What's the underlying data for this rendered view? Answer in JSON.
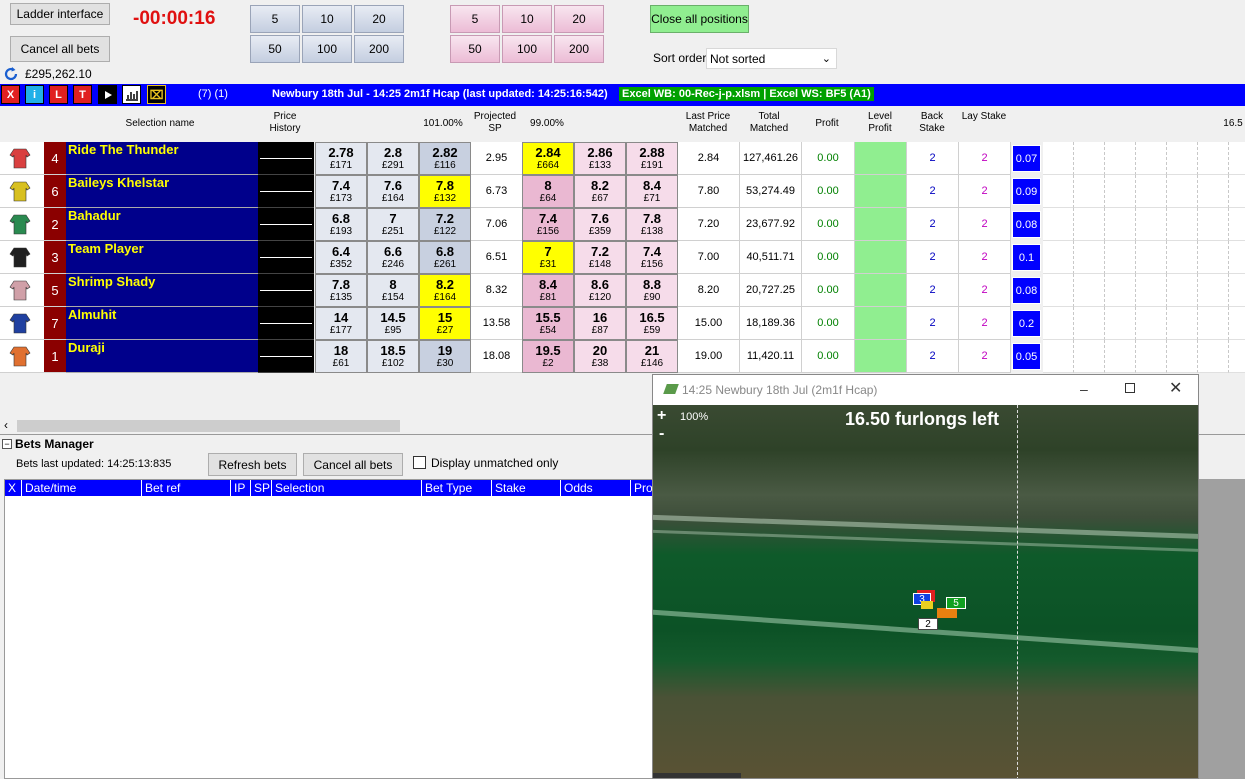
{
  "controls": {
    "ladder_btn": "Ladder interface",
    "cancel_all_btn": "Cancel all bets",
    "timer": "-00:00:16",
    "balance": "£295,262.10",
    "back_stakes": [
      "5",
      "10",
      "20",
      "50",
      "100",
      "200"
    ],
    "lay_stakes": [
      "5",
      "10",
      "20",
      "50",
      "100",
      "200"
    ],
    "close_all_btn": "Close all positions",
    "sort_label": "Sort order",
    "sort_value": "Not sorted"
  },
  "toolbar": {
    "buttons": [
      "X",
      "i",
      "L",
      "T"
    ],
    "counts": "(7) (1)",
    "market_title": "Newbury 18th Jul - 14:25 2m1f Hcap (last updated: 14:25:16:542)",
    "excel_status": "Excel WB: 00-Rec-j-p.xlsm | Excel WS: BF5 (A1)"
  },
  "headers": {
    "selection": "Selection name",
    "price_history": "Price History",
    "back_pct": "101.00%",
    "projected_sp": "Projected SP",
    "lay_pct": "99.00%",
    "last_price": "Last Price Matched",
    "total_matched": "Total Matched",
    "profit": "Profit",
    "level_profit": "Level Profit",
    "back_stake": "Back Stake",
    "lay_stake": "Lay Stake",
    "ladder_start": "16.5"
  },
  "runners": [
    {
      "num": "4",
      "name": "Ride The Thunder",
      "silk": "#d94040",
      "back": [
        {
          "o": "2.78",
          "s": "£171"
        },
        {
          "o": "2.8",
          "s": "£291"
        },
        {
          "o": "2.82",
          "s": "£116"
        }
      ],
      "sp": "2.95",
      "lay": [
        {
          "o": "2.84",
          "s": "£664"
        },
        {
          "o": "2.86",
          "s": "£133"
        },
        {
          "o": "2.88",
          "s": "£191"
        }
      ],
      "lpm": "2.84",
      "tm": "127,461.26",
      "profit": "0.00",
      "bs": "2",
      "ls": "2",
      "ladder": "0.07",
      "bhl": -1,
      "lhl": 0
    },
    {
      "num": "6",
      "name": "Baileys Khelstar",
      "silk": "#d8c020",
      "back": [
        {
          "o": "7.4",
          "s": "£173"
        },
        {
          "o": "7.6",
          "s": "£164"
        },
        {
          "o": "7.8",
          "s": "£132"
        }
      ],
      "sp": "6.73",
      "lay": [
        {
          "o": "8",
          "s": "£64"
        },
        {
          "o": "8.2",
          "s": "£67"
        },
        {
          "o": "8.4",
          "s": "£71"
        }
      ],
      "lpm": "7.80",
      "tm": "53,274.49",
      "profit": "0.00",
      "bs": "2",
      "ls": "2",
      "ladder": "0.09",
      "bhl": 2,
      "lhl": -1
    },
    {
      "num": "2",
      "name": "Bahadur",
      "silk": "#2a8a50",
      "back": [
        {
          "o": "6.8",
          "s": "£193"
        },
        {
          "o": "7",
          "s": "£251"
        },
        {
          "o": "7.2",
          "s": "£122"
        }
      ],
      "sp": "7.06",
      "lay": [
        {
          "o": "7.4",
          "s": "£156"
        },
        {
          "o": "7.6",
          "s": "£359"
        },
        {
          "o": "7.8",
          "s": "£138"
        }
      ],
      "lpm": "7.20",
      "tm": "23,677.92",
      "profit": "0.00",
      "bs": "2",
      "ls": "2",
      "ladder": "0.08",
      "bhl": -1,
      "lhl": -1
    },
    {
      "num": "3",
      "name": "Team Player",
      "silk": "#202020",
      "back": [
        {
          "o": "6.4",
          "s": "£352"
        },
        {
          "o": "6.6",
          "s": "£246"
        },
        {
          "o": "6.8",
          "s": "£261"
        }
      ],
      "sp": "6.51",
      "lay": [
        {
          "o": "7",
          "s": "£31"
        },
        {
          "o": "7.2",
          "s": "£148"
        },
        {
          "o": "7.4",
          "s": "£156"
        }
      ],
      "lpm": "7.00",
      "tm": "40,511.71",
      "profit": "0.00",
      "bs": "2",
      "ls": "2",
      "ladder": "0.1",
      "bhl": -1,
      "lhl": 0
    },
    {
      "num": "5",
      "name": "Shrimp Shady",
      "silk": "#d0a0a8",
      "back": [
        {
          "o": "7.8",
          "s": "£135"
        },
        {
          "o": "8",
          "s": "£154"
        },
        {
          "o": "8.2",
          "s": "£164"
        }
      ],
      "sp": "8.32",
      "lay": [
        {
          "o": "8.4",
          "s": "£81"
        },
        {
          "o": "8.6",
          "s": "£120"
        },
        {
          "o": "8.8",
          "s": "£90"
        }
      ],
      "lpm": "8.20",
      "tm": "20,727.25",
      "profit": "0.00",
      "bs": "2",
      "ls": "2",
      "ladder": "0.08",
      "bhl": 2,
      "lhl": -1
    },
    {
      "num": "7",
      "name": "Almuhit",
      "silk": "#2040a0",
      "back": [
        {
          "o": "14",
          "s": "£177"
        },
        {
          "o": "14.5",
          "s": "£95"
        },
        {
          "o": "15",
          "s": "£27"
        }
      ],
      "sp": "13.58",
      "lay": [
        {
          "o": "15.5",
          "s": "£54"
        },
        {
          "o": "16",
          "s": "£87"
        },
        {
          "o": "16.5",
          "s": "£59"
        }
      ],
      "lpm": "15.00",
      "tm": "18,189.36",
      "profit": "0.00",
      "bs": "2",
      "ls": "2",
      "ladder": "0.2",
      "bhl": 2,
      "lhl": -1
    },
    {
      "num": "1",
      "name": "Duraji",
      "silk": "#e07030",
      "back": [
        {
          "o": "18",
          "s": "£61"
        },
        {
          "o": "18.5",
          "s": "£102"
        },
        {
          "o": "19",
          "s": "£30"
        }
      ],
      "sp": "18.08",
      "lay": [
        {
          "o": "19.5",
          "s": "£2"
        },
        {
          "o": "20",
          "s": "£38"
        },
        {
          "o": "21",
          "s": "£146"
        }
      ],
      "lpm": "19.00",
      "tm": "11,420.11",
      "profit": "0.00",
      "bs": "2",
      "ls": "2",
      "ladder": "0.05",
      "bhl": -1,
      "lhl": -1
    }
  ],
  "bets_manager": {
    "title": "Bets Manager",
    "last_updated": "Bets last updated: 14:25:13:835",
    "refresh_btn": "Refresh bets",
    "cancel_btn": "Cancel all bets",
    "unmatched_label": "Display unmatched only",
    "columns": [
      "X",
      "Date/time",
      "Bet ref",
      "IP",
      "SP",
      "Selection",
      "Bet Type",
      "Stake",
      "Odds",
      "Pro"
    ]
  },
  "race_window": {
    "title": "14:25 Newbury 18th Jul (2m1f Hcap)",
    "zoom": "100%",
    "distance": "16.50 furlongs left",
    "plus": "+",
    "minus": "-",
    "markers": [
      "3",
      "5",
      "2"
    ]
  }
}
